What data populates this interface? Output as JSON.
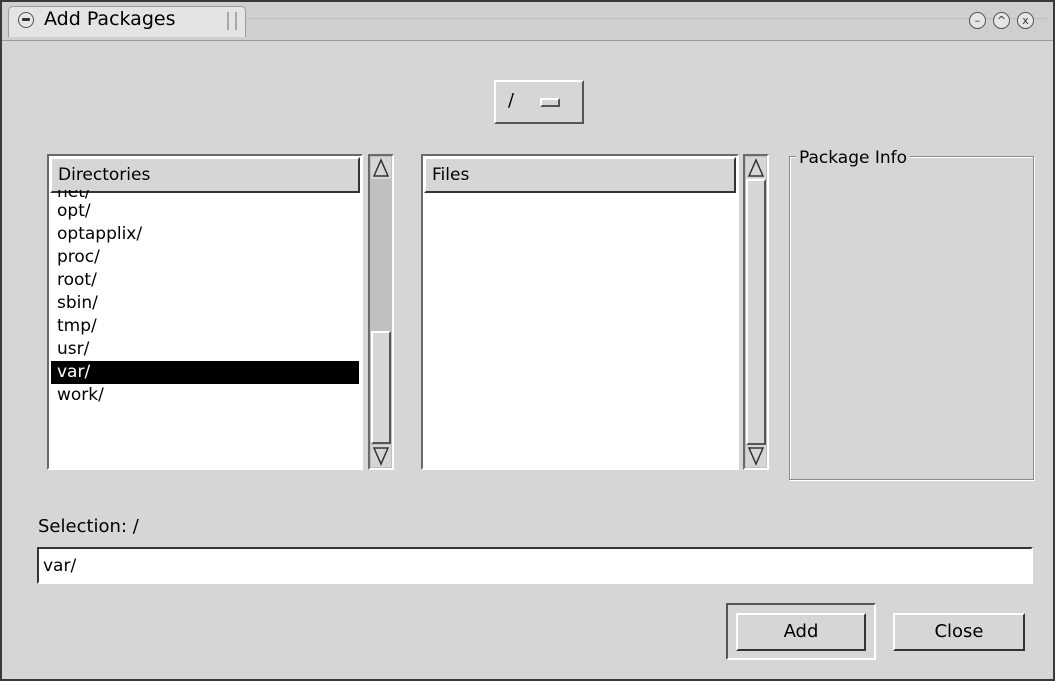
{
  "window": {
    "title": "Add Packages",
    "controls": [
      "minimize-icon",
      "maximize-icon",
      "close-icon"
    ]
  },
  "path_dropdown": {
    "value": "/"
  },
  "directories": {
    "header": "Directories",
    "partial_item": "net/",
    "items": [
      "opt/",
      "optapplix/",
      "proc/",
      "root/",
      "sbin/",
      "tmp/",
      "usr/",
      "var/",
      "work/"
    ],
    "selected": "var/"
  },
  "files": {
    "header": "Files",
    "items": []
  },
  "package_info": {
    "label": "Package Info"
  },
  "selection": {
    "label": "Selection: /",
    "value": "var/"
  },
  "buttons": {
    "add": "Add",
    "close": "Close"
  }
}
